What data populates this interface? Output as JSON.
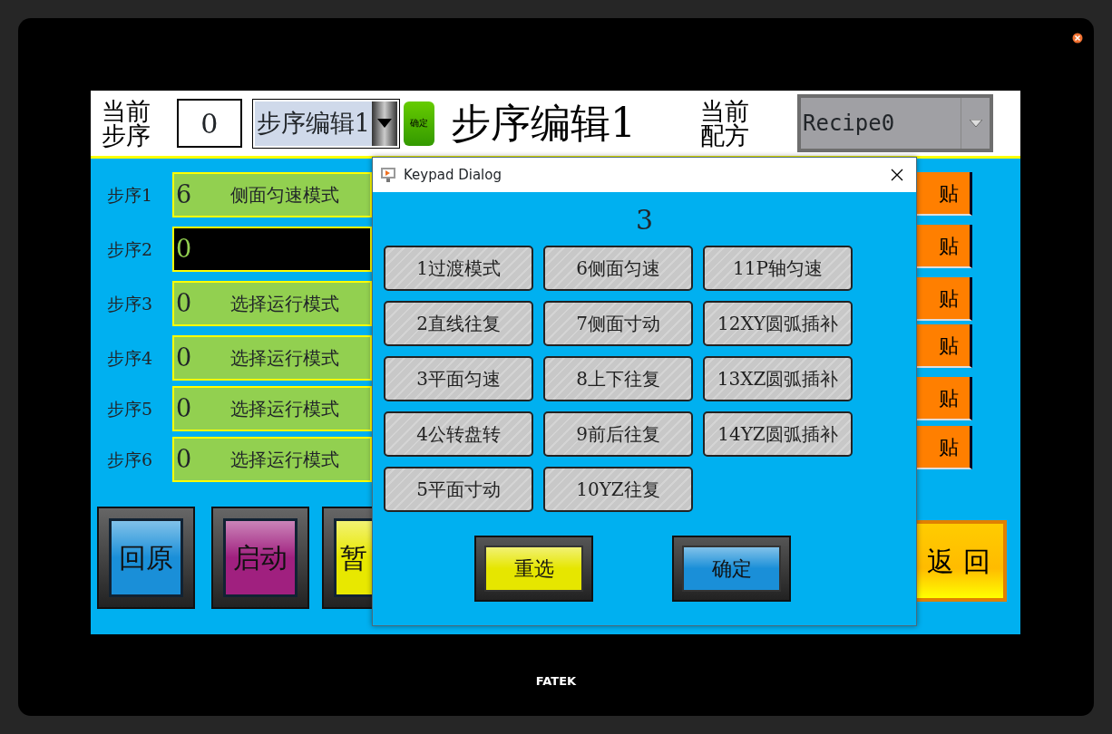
{
  "header": {
    "step_label": "当前步序",
    "step_value": "0",
    "edit_select": {
      "value": "步序编辑1"
    },
    "confirm_button": "确定",
    "title": "步序编辑1",
    "recipe_label": "当前配方",
    "recipe_select": {
      "value": "Recipe0"
    }
  },
  "steps": [
    {
      "label": "步序1",
      "value": "6",
      "mode": "侧面匀速模式",
      "active": false
    },
    {
      "label": "步序2",
      "value": "0",
      "active": true
    },
    {
      "label": "步序3",
      "value": "0",
      "mode": "选择运行模式",
      "active": false
    },
    {
      "label": "步序4",
      "value": "0",
      "mode": "选择运行模式",
      "active": false
    },
    {
      "label": "步序5",
      "value": "0",
      "mode": "选择运行模式",
      "active": false
    },
    {
      "label": "步序6",
      "value": "0",
      "mode": "选择运行模式",
      "active": false
    }
  ],
  "paste_buttons": [
    "贴",
    "贴",
    "贴",
    "贴",
    "贴",
    "贴"
  ],
  "action_buttons": [
    {
      "label": "回原",
      "color": "#1a8fd8"
    },
    {
      "label": "启动",
      "color": "#a0207f"
    },
    {
      "label": "暂",
      "color": "#e8e800"
    }
  ],
  "return_button": "返 回",
  "dialog": {
    "title": "Keypad Dialog",
    "display": "3",
    "keys": [
      "1过渡模式",
      "6侧面匀速",
      "11P轴匀速",
      "2直线往复",
      "7侧面寸动",
      "12XY圆弧插补",
      "3平面匀速",
      "8上下往复",
      "13XZ圆弧插补",
      "4公转盘转",
      "9前后往复",
      "14YZ圆弧插补",
      "5平面寸动",
      "10YZ往复"
    ],
    "buttons": [
      {
        "label": "重选",
        "color": "#e6e600"
      },
      {
        "label": "确定",
        "color": "#1a8fd8"
      }
    ]
  },
  "brand": "FATEK"
}
